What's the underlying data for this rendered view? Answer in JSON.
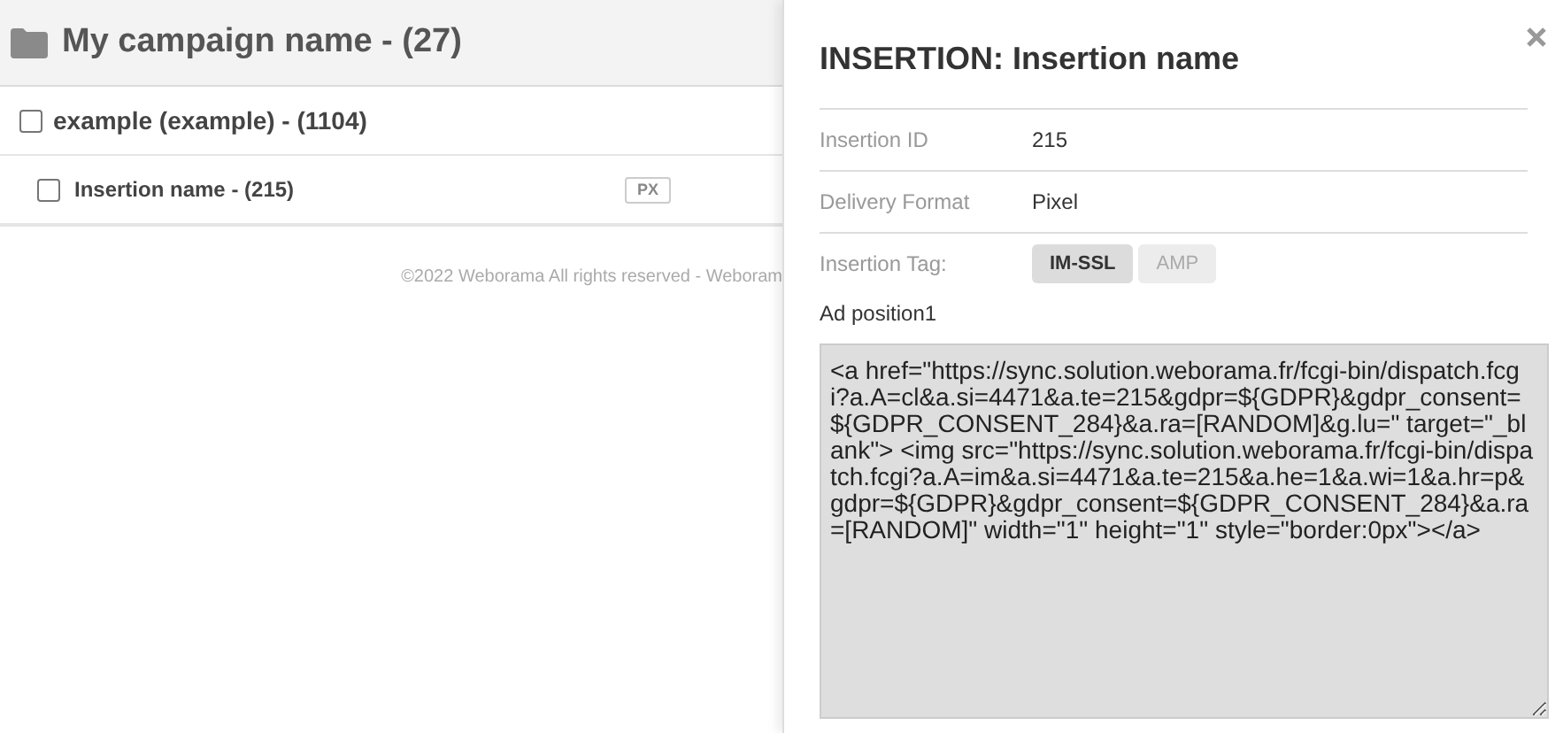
{
  "campaign": {
    "title": "My campaign name - (27)"
  },
  "tree": [
    {
      "label": "example (example) - (1104)",
      "checked": false,
      "children": [
        {
          "label": "Insertion name - (215)",
          "checked": false,
          "badge": "PX"
        }
      ]
    }
  ],
  "footer": "©2022 Weborama All rights reserved - Weboram",
  "panel": {
    "title_prefix": "INSERTION:",
    "title": "Insertion name",
    "fields": [
      {
        "label": "Insertion ID",
        "value": "215"
      },
      {
        "label": "Delivery Format",
        "value": "Pixel"
      }
    ],
    "tag_label": "Insertion Tag:",
    "tags": [
      {
        "label": "IM-SSL",
        "selected": true
      },
      {
        "label": "AMP",
        "selected": false
      }
    ],
    "code_label": "Ad position1",
    "code": "<a href=\"https://sync.solution.weborama.fr/fcgi-bin/dispatch.fcgi?a.A=cl&a.si=4471&a.te=215&gdpr=${GDPR}&gdpr_consent=${GDPR_CONSENT_284}&a.ra=[RANDOM]&g.lu=\" target=\"_blank\"> <img src=\"https://sync.solution.weborama.fr/fcgi-bin/dispatch.fcgi?a.A=im&a.si=4471&a.te=215&a.he=1&a.wi=1&a.hr=p&gdpr=${GDPR}&gdpr_consent=${GDPR_CONSENT_284}&a.ra=[RANDOM]\" width=\"1\" height=\"1\" style=\"border:0px\"></a>"
  }
}
